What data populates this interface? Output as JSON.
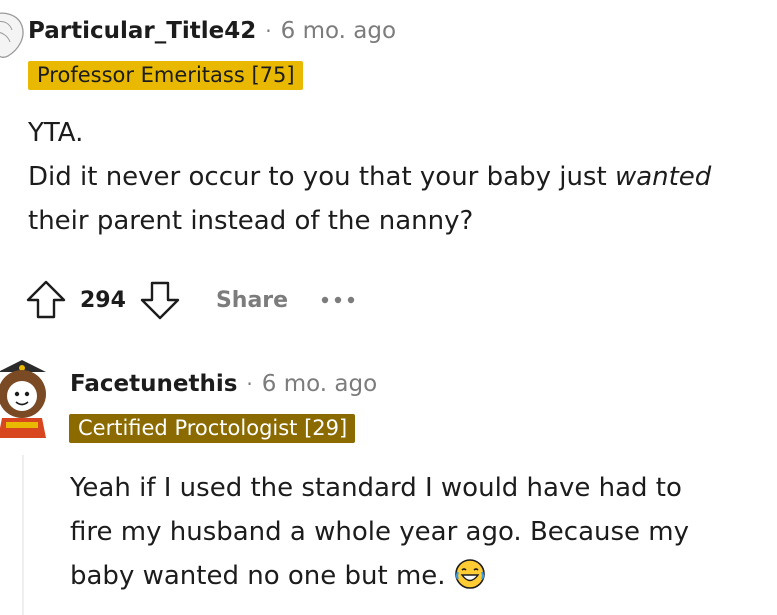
{
  "comment1": {
    "username": "Particular_Title42",
    "separator": "·",
    "age": "6 mo. ago",
    "flair": "Professor Emeritass [75]",
    "flair_bg": "#e8b900",
    "body_line1": "YTA.",
    "body_line2_pre": "Did it never occur to you that your baby just ",
    "body_line2_em": "wanted",
    "body_line3": "their parent instead of the nanny?",
    "score": "294",
    "share_label": "Share"
  },
  "comment2": {
    "username": "Facetunethis",
    "separator": "·",
    "age": "6 mo. ago",
    "flair": "Certified Proctologist [29]",
    "flair_bg": "#8b6a00",
    "body_line1": "Yeah if I used the standard I would have had to",
    "body_line2": "fire my husband a whole year ago. Because my",
    "body_line3": "baby wanted no one but me.",
    "emoji": "laughing-crying-emoji"
  }
}
